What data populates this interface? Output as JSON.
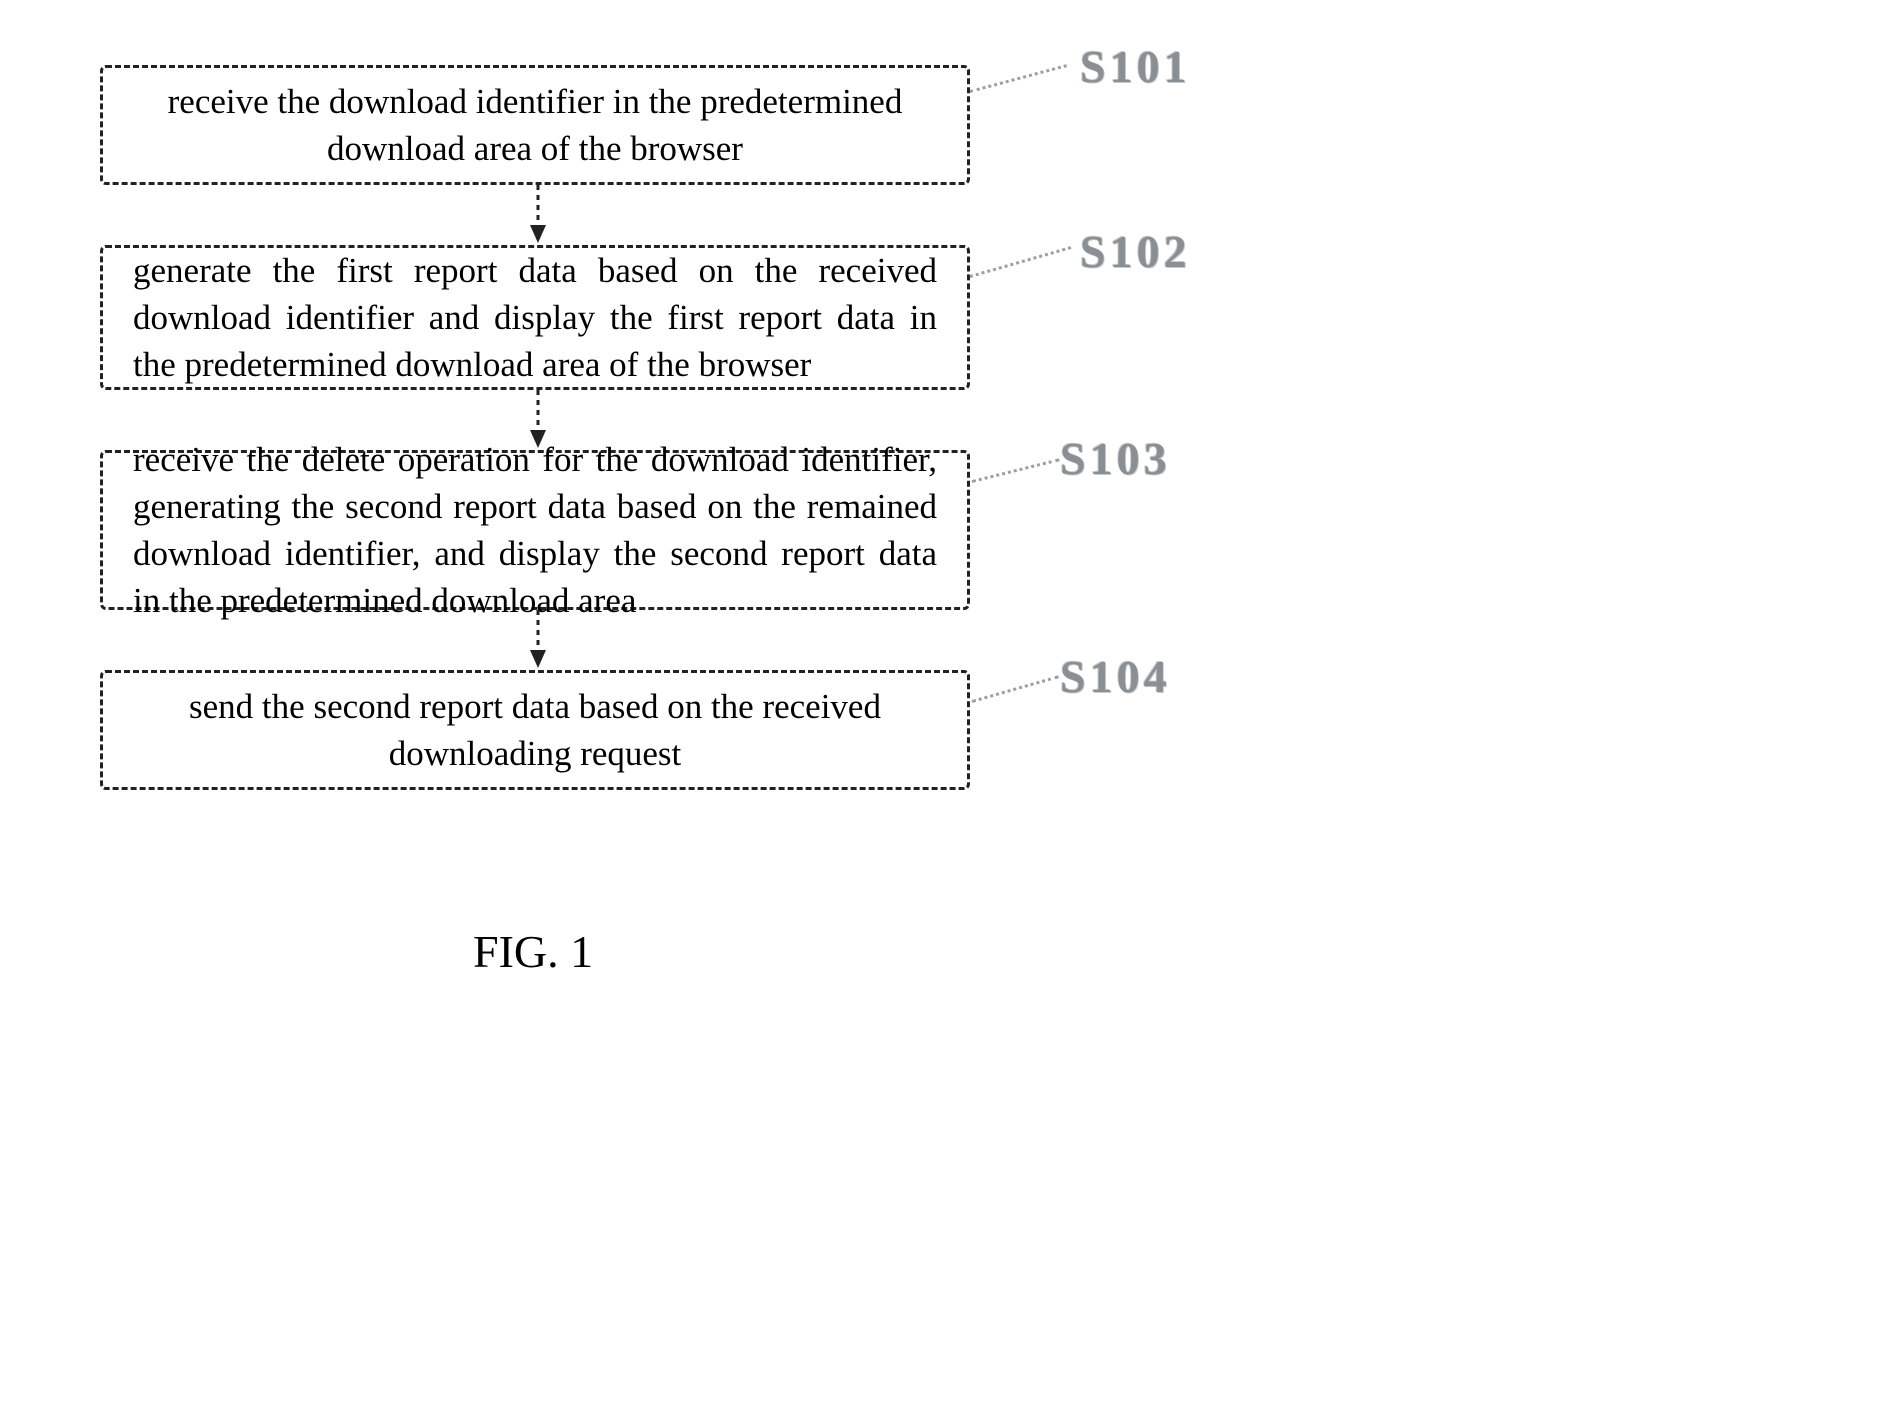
{
  "chart_data": {
    "type": "flowchart",
    "title": "FIG. 1",
    "nodes": [
      {
        "id": "S101",
        "label": "S101",
        "text": "receive the download identifier in the predetermined download area of the browser"
      },
      {
        "id": "S102",
        "label": "S102",
        "text": "generate the first report data based on the received download identifier and display the first report data in the predetermined download area of the browser"
      },
      {
        "id": "S103",
        "label": "S103",
        "text": "receive the delete operation for the download identifier, generating the second report data based on the remained download identifier, and display the second report data in the predetermined download area"
      },
      {
        "id": "S104",
        "label": "S104",
        "text": "send the second report data based on the received downloading request"
      }
    ],
    "edges": [
      {
        "from": "S101",
        "to": "S102"
      },
      {
        "from": "S102",
        "to": "S103"
      },
      {
        "from": "S103",
        "to": "S104"
      }
    ]
  },
  "caption": "FIG. 1"
}
